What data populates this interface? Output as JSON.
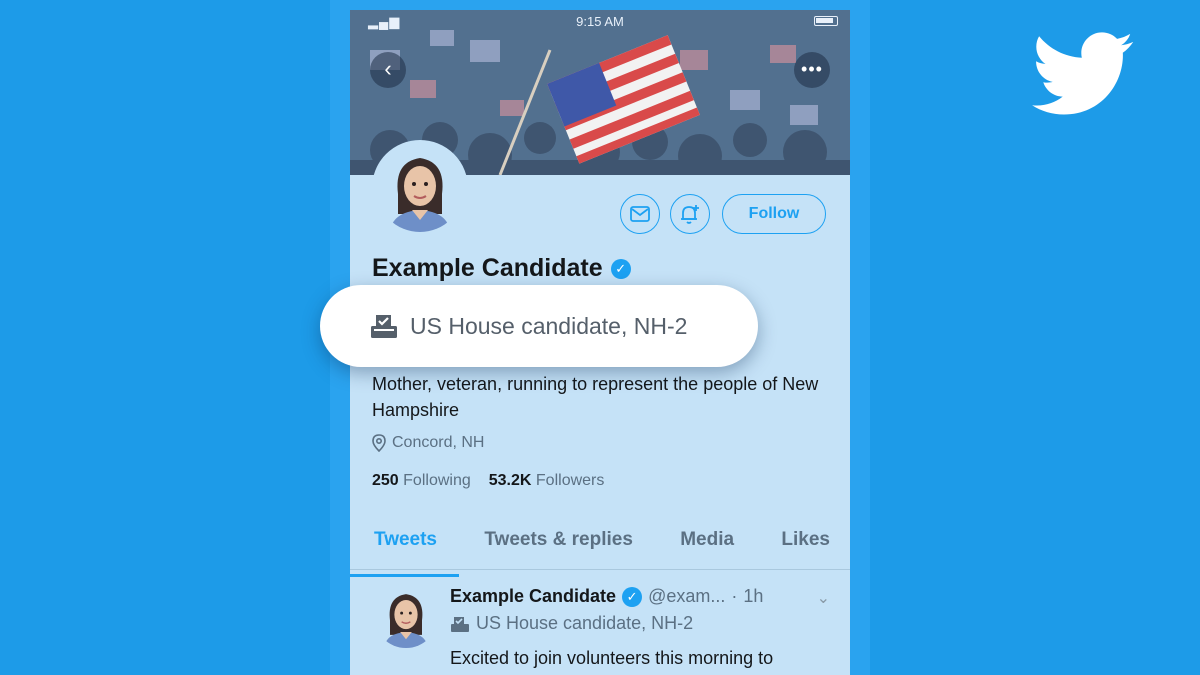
{
  "status_bar": {
    "time": "9:15 AM"
  },
  "profile": {
    "name": "Example Candidate",
    "verified_icon": "check-icon",
    "election_label": "US House candidate, NH-2",
    "bio": "Mother, veteran, running to represent the people of New Hampshire",
    "location": "Concord, NH",
    "following_count": "250",
    "following_label": "Following",
    "followers_count": "53.2K",
    "followers_label": "Followers"
  },
  "actions": {
    "message_icon": "envelope-icon",
    "notify_icon": "bell-plus-icon",
    "follow_label": "Follow"
  },
  "tabs": [
    {
      "label": "Tweets",
      "active": true
    },
    {
      "label": "Tweets & replies",
      "active": false
    },
    {
      "label": "Media",
      "active": false
    },
    {
      "label": "Likes",
      "active": false
    }
  ],
  "tweet": {
    "author": "Example Candidate",
    "handle": "@exam...",
    "separator": "·",
    "time": "1h",
    "label": "US House candidate, NH-2",
    "text": "Excited to join volunteers this morning to"
  },
  "highlight": {
    "label": "US House candidate, NH-2",
    "icon": "ballot-box-icon"
  },
  "colors": {
    "background": "#1d9be8",
    "accent": "#1da1f2",
    "screen_tint": "#c5e2f7"
  }
}
